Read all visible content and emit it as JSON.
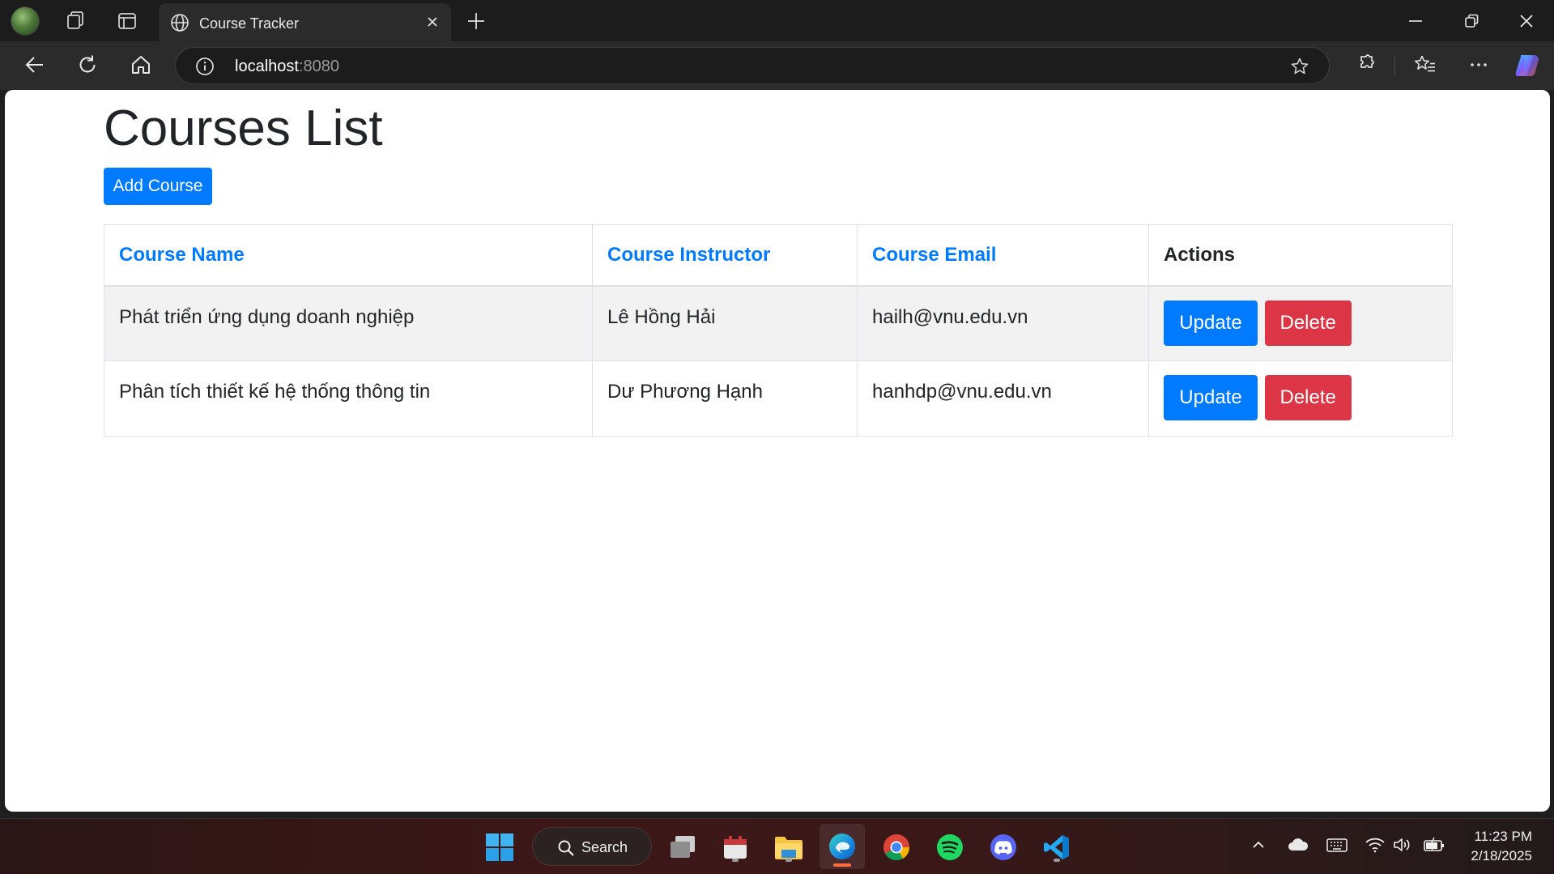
{
  "browser": {
    "tab_title": "Course Tracker",
    "url_host": "localhost",
    "url_port": ":8080"
  },
  "page": {
    "title": "Courses List",
    "add_button_label": "Add Course"
  },
  "table": {
    "headers": {
      "name": "Course Name",
      "instructor": "Course Instructor",
      "email": "Course Email",
      "actions": "Actions"
    },
    "rows": [
      {
        "name": "Phát triển ứng dụng doanh nghiệp",
        "instructor": "Lê Hồng Hải",
        "email": "hailh@vnu.edu.vn",
        "update_label": "Update",
        "delete_label": "Delete"
      },
      {
        "name": "Phân tích thiết kế hệ thống thông tin",
        "instructor": "Dư Phương Hạnh",
        "email": "hanhdp@vnu.edu.vn",
        "update_label": "Update",
        "delete_label": "Delete"
      }
    ]
  },
  "taskbar": {
    "search_label": "Search",
    "time": "11:23 PM",
    "date": "2/18/2025"
  },
  "colors": {
    "primary": "#007bff",
    "danger": "#dc3545",
    "header_link": "#007bff"
  }
}
